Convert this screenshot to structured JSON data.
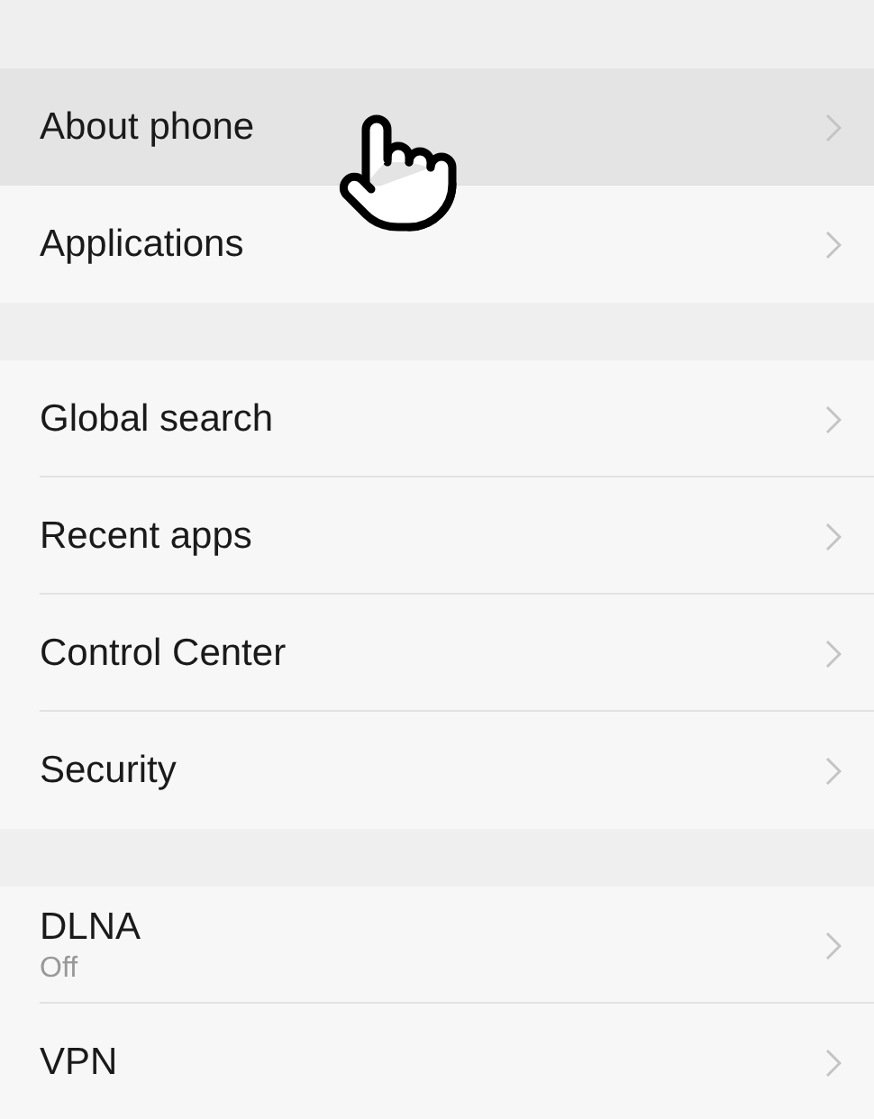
{
  "sections": [
    {
      "items": [
        {
          "label": "About phone",
          "selected": true
        },
        {
          "label": "Applications",
          "selected": false
        }
      ]
    },
    {
      "items": [
        {
          "label": "Global search",
          "selected": false
        },
        {
          "label": "Recent apps",
          "selected": false
        },
        {
          "label": "Control Center",
          "selected": false
        },
        {
          "label": "Security",
          "selected": false
        }
      ]
    },
    {
      "items": [
        {
          "label": "DLNA",
          "subtitle": "Off",
          "selected": false
        },
        {
          "label": "VPN",
          "selected": false
        }
      ]
    }
  ]
}
